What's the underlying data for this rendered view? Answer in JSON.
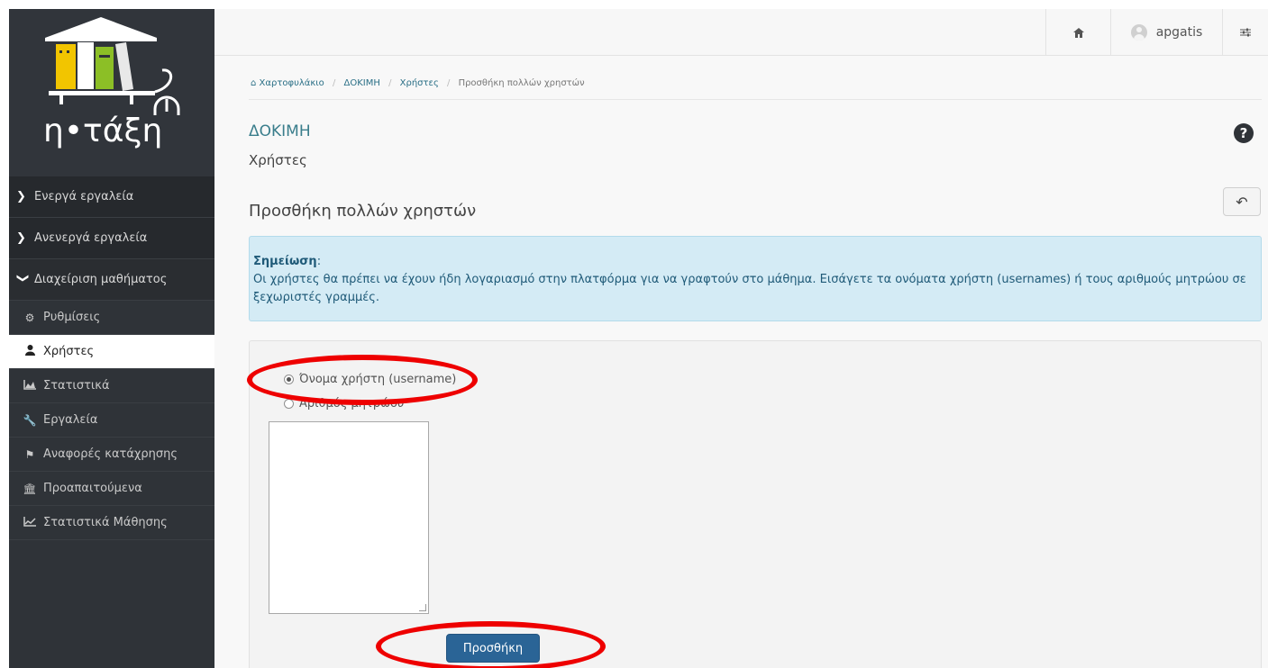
{
  "logo": {
    "text": "η•τάξη"
  },
  "topbar": {
    "username": "apgatis"
  },
  "sidebar": {
    "sections": [
      {
        "label": "Ενεργά εργαλεία"
      },
      {
        "label": "Ανενεργά εργαλεία"
      },
      {
        "label": "Διαχείριση μαθήματος"
      }
    ],
    "items": [
      {
        "label": "Ρυθμίσεις",
        "icon": "gears-icon"
      },
      {
        "label": "Χρήστες",
        "icon": "user-icon"
      },
      {
        "label": "Στατιστικά",
        "icon": "area-chart-icon"
      },
      {
        "label": "Εργαλεία",
        "icon": "wrench-icon"
      },
      {
        "label": "Αναφορές κατάχρησης",
        "icon": "flag-icon"
      },
      {
        "label": "Προαπαιτούμενα",
        "icon": "institution-icon"
      },
      {
        "label": "Στατιστικά Μάθησης",
        "icon": "line-chart-icon"
      }
    ]
  },
  "breadcrumb": {
    "items": [
      "Χαρτοφυλάκιο",
      "ΔΟΚΙΜΗ",
      "Χρήστες",
      "Προσθήκη πολλών χρηστών"
    ]
  },
  "course": {
    "title": "ΔΟΚΙΜΗ",
    "subtitle": "Χρήστες"
  },
  "page": {
    "title": "Προσθήκη πολλών χρηστών"
  },
  "alert": {
    "title": "Σημείωση",
    "colon": ":",
    "text": "Οι χρήστες θα πρέπει να έχουν ήδη λογαριασμό στην πλατφόρμα για να γραφτούν στο μάθημα. Εισάγετε τα ονόματα χρήστη (usernames) ή τους αριθμούς μητρώου σε ξεχωριστές γραμμές."
  },
  "form": {
    "radio_username": "Όνομα χρήστη (username)",
    "radio_am": "Αριθμός μητρώου",
    "submit_label": "Προσθήκη"
  },
  "colors": {
    "sidebar_bg": "#2f3338",
    "accent": "#3a7e8c",
    "button": "#2a6496",
    "alert_bg": "#d4ebf5",
    "highlight": "#ee0000"
  }
}
